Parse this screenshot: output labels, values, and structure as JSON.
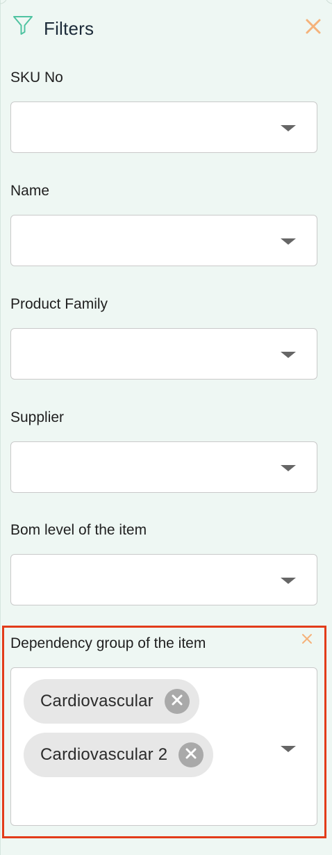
{
  "panel": {
    "title": "Filters",
    "icons": {
      "filter": "filter-icon",
      "close": "close-icon"
    },
    "colors": {
      "background": "#eef7f3",
      "filter_icon": "#4fc3a1",
      "close_icon": "#f5b27a",
      "highlight": "#e23c1a",
      "chip_background": "#e7e7e7",
      "chip_remove": "#a9a9a9"
    }
  },
  "fields": [
    {
      "label": "SKU No",
      "value": ""
    },
    {
      "label": "Name",
      "value": ""
    },
    {
      "label": "Product Family",
      "value": ""
    },
    {
      "label": "Supplier",
      "value": ""
    },
    {
      "label": "Bom level of the item",
      "value": ""
    }
  ],
  "dependency_group": {
    "label": "Dependency group of the item",
    "selected": [
      {
        "label": "Cardiovascular"
      },
      {
        "label": "Cardiovascular 2"
      }
    ]
  }
}
